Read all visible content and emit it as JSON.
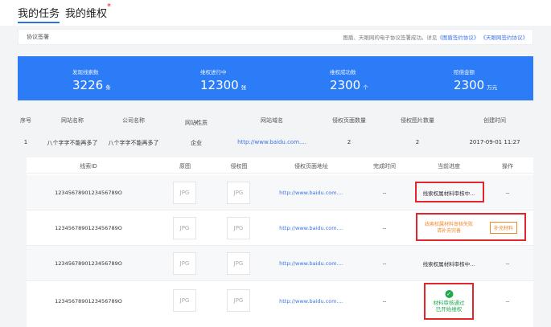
{
  "tabs": {
    "my_tasks": "我的任务",
    "my_rights": "我的维权",
    "badge": "*"
  },
  "notice": {
    "label": "协议签署",
    "text": "图盾、天眼网的电子协议签署成功。详见",
    "link1": "《图盾签约协议》",
    "link2": "《天眼网签约协议》"
  },
  "stats": [
    {
      "label": "发现线索数",
      "value": "3226",
      "unit": "条"
    },
    {
      "label": "维权进行中",
      "value": "12300",
      "unit": "张"
    },
    {
      "label": "维权成功数",
      "value": "2300",
      "unit": "个"
    },
    {
      "label": "赔偿金额",
      "value": "2300",
      "unit": "万元"
    }
  ],
  "table": {
    "headers": [
      "序号",
      "网站名称",
      "公司名称",
      "网站性质",
      "网站域名",
      "侵权页面数量",
      "侵权图片数量",
      "创建时间"
    ],
    "caret": "∨",
    "row": {
      "index": "1",
      "site_name": "八个字字不能再多了",
      "company": "八个字字不能再多了",
      "nature": "企业",
      "domain": "http://www.baidu.com....",
      "pages": "2",
      "images": "2",
      "created": "2017-09-01 11:27"
    }
  },
  "inner": {
    "headers": [
      "线索ID",
      "原图",
      "侵权图",
      "侵权页面地址",
      "完成时间",
      "当前进度",
      "操作"
    ],
    "rows": [
      {
        "id": "1234567890123456789O",
        "orig": "JPG",
        "infr": "JPG",
        "url": "http://www.baidu.com....",
        "time": "--",
        "status": "线索权属材料审核中...",
        "op": "--"
      },
      {
        "id": "1234567890123456789O",
        "orig": "JPG",
        "infr": "JPG",
        "url": "http://www.baidu.com....",
        "time": "--",
        "status_line1": "线索权属材料审核失败",
        "status_line2": "请补充完善",
        "op": "补充材料"
      },
      {
        "id": "1234567890123456789O",
        "orig": "JPG",
        "infr": "JPG",
        "url": "http://www.baidu.com....",
        "time": "--",
        "status": "线索权属材料审核中...",
        "op": "--"
      },
      {
        "id": "1234567890123456789O",
        "orig": "JPG",
        "infr": "JPG",
        "url": "http://www.baidu.com....",
        "time": "--",
        "status_line1": "材料审核通过",
        "status_line2": "已开始维权",
        "op": "--"
      }
    ]
  },
  "colors": {
    "accent": "#2d7cf7",
    "warn": "#ef8a2d",
    "success": "#22a84d",
    "highlight": "#e3262b"
  }
}
